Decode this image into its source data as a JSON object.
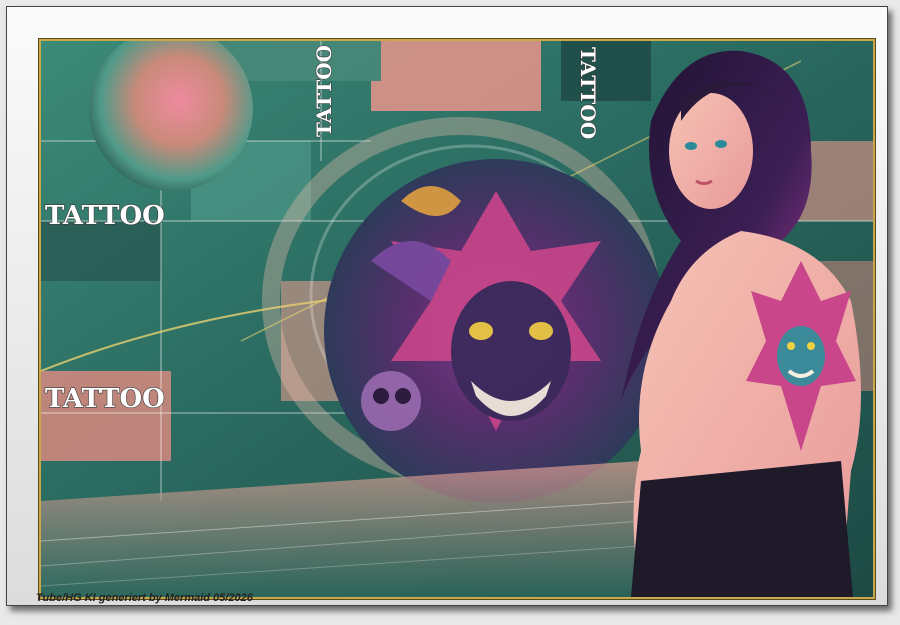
{
  "artwork": {
    "overlay_words": [
      "TATTOO",
      "TATTOO",
      "TATTOO",
      "TATTOO"
    ]
  },
  "caption": "Tube/HG KI generiert by Mermaid 05/2026",
  "colors": {
    "teal": "#2e7a6c",
    "salmon": "#e9958c",
    "gold_border": "#c9a84a",
    "hair": "#2a1a3a",
    "skin": "#f2b2a8"
  }
}
